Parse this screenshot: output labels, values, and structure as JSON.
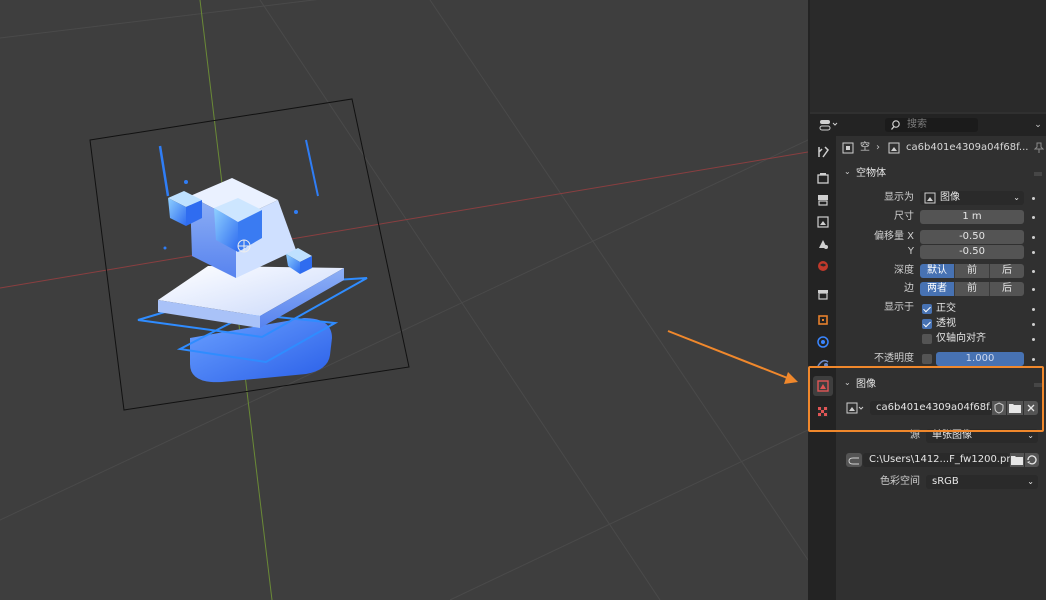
{
  "viewport": {
    "description_label": "3D Viewport"
  },
  "header": {
    "search_placeholder": "搜索"
  },
  "breadcrumb": {
    "object": "空",
    "image_name": "ca6b401e4309a04f68f..."
  },
  "empty_section": {
    "title": "空物体",
    "display_as_label": "显示为",
    "display_as_value": "图像",
    "size_label": "尺寸",
    "size_value": "1 m",
    "offset_x_label": "偏移量 X",
    "offset_x_value": "-0.50",
    "offset_y_label": "Y",
    "offset_y_value": "-0.50",
    "depth_label": "深度",
    "depth_options": [
      "默认",
      "前",
      "后"
    ],
    "depth_selected": 0,
    "side_label": "边",
    "side_options": [
      "两者",
      "前",
      "后"
    ],
    "side_selected": 0,
    "show_in_label": "显示于",
    "ortho_label": "正交",
    "ortho_checked": true,
    "persp_label": "透视",
    "persp_checked": true,
    "axis_aligned_label": "仅轴向对齐",
    "axis_aligned_checked": false,
    "opacity_label": "不透明度",
    "opacity_value": "1.000"
  },
  "image_section": {
    "title": "图像",
    "datablock_name": "ca6b401e4309a04f68f...",
    "source_label": "源",
    "source_value": "单张图像",
    "filepath": "C:\\Users\\1412...F_fw1200.png",
    "colorspace_label": "色彩空间",
    "colorspace_value": "sRGB"
  },
  "colors": {
    "accent": "#4772b3",
    "annotation": "#f0882c",
    "viewport_bg": "#3e3e3e",
    "panel_bg": "#303030"
  }
}
